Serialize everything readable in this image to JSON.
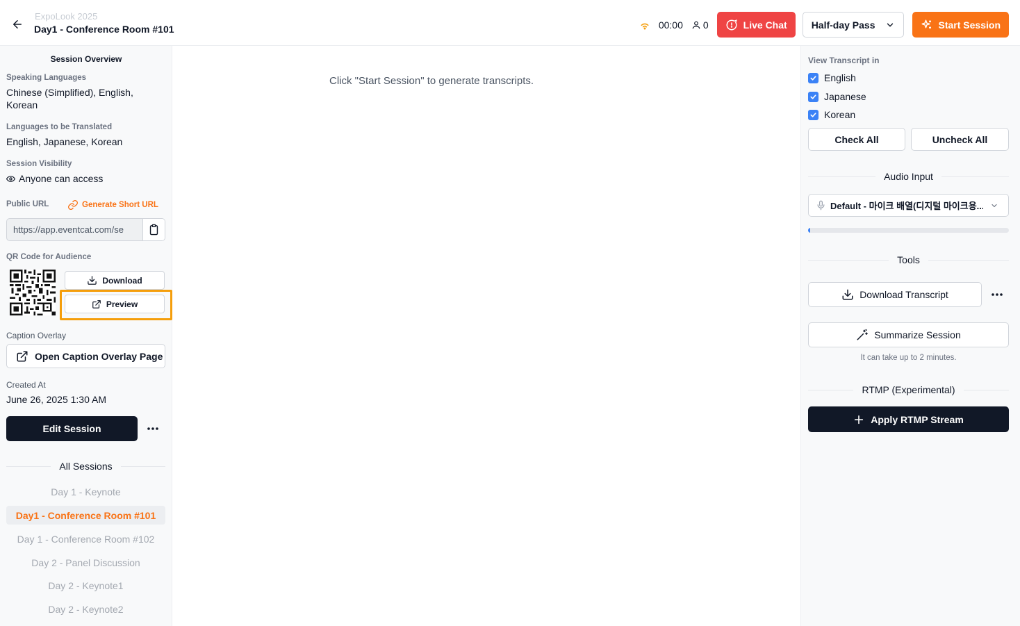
{
  "header": {
    "event_name": "ExpoLook 2025",
    "session_title": "Day1 - Conference Room #101",
    "timer": "00:00",
    "viewer_count": "0",
    "live_chat_label": "Live Chat",
    "pass_label": "Half-day Pass",
    "start_label": "Start Session"
  },
  "left_panel": {
    "title": "Session Overview",
    "speaking_label": "Speaking Languages",
    "speaking_value": "Chinese (Simplified), English, Korean",
    "translated_label": "Languages to be Translated",
    "translated_value": "English, Japanese, Korean",
    "visibility_label": "Session Visibility",
    "visibility_value": "Anyone can access",
    "public_url_label": "Public URL",
    "short_url_label": "Generate Short URL",
    "public_url_value": "https://app.eventcat.com/se",
    "qr_label": "QR Code for Audience",
    "download_label": "Download",
    "preview_label": "Preview",
    "caption_label": "Caption Overlay",
    "caption_button": "Open Caption Overlay Page",
    "created_label": "Created At",
    "created_value": "June 26, 2025 1:30 AM",
    "edit_label": "Edit Session",
    "all_sessions_label": "All Sessions",
    "sessions": [
      {
        "label": "Day 1 - Keynote"
      },
      {
        "label": "Day1 - Conference Room #101"
      },
      {
        "label": "Day 1 - Conference Room #102"
      },
      {
        "label": "Day 2 - Panel Discussion"
      },
      {
        "label": "Day 2 - Keynote1"
      },
      {
        "label": "Day 2 - Keynote2"
      }
    ]
  },
  "main": {
    "empty_message": "Click \"Start Session\" to generate transcripts."
  },
  "right_panel": {
    "view_label": "View Transcript in",
    "languages": [
      {
        "label": "English",
        "checked": true
      },
      {
        "label": "Japanese",
        "checked": true
      },
      {
        "label": "Korean",
        "checked": true
      }
    ],
    "check_all": "Check All",
    "uncheck_all": "Uncheck All",
    "audio_title": "Audio Input",
    "audio_device": "Default - 마이크 배열(디지털 마이크용...",
    "audio_level": 0.01,
    "tools_title": "Tools",
    "download_transcript": "Download Transcript",
    "summarize": "Summarize Session",
    "summarize_hint": "It can take up to 2 minutes.",
    "rtmp_title": "RTMP (Experimental)",
    "rtmp_button": "Apply RTMP Stream"
  },
  "colors": {
    "accent": "#f97316",
    "live": "#ef4444",
    "dark": "#111827",
    "checkbox": "#3b82f6",
    "highlight": "#f59e0b"
  }
}
